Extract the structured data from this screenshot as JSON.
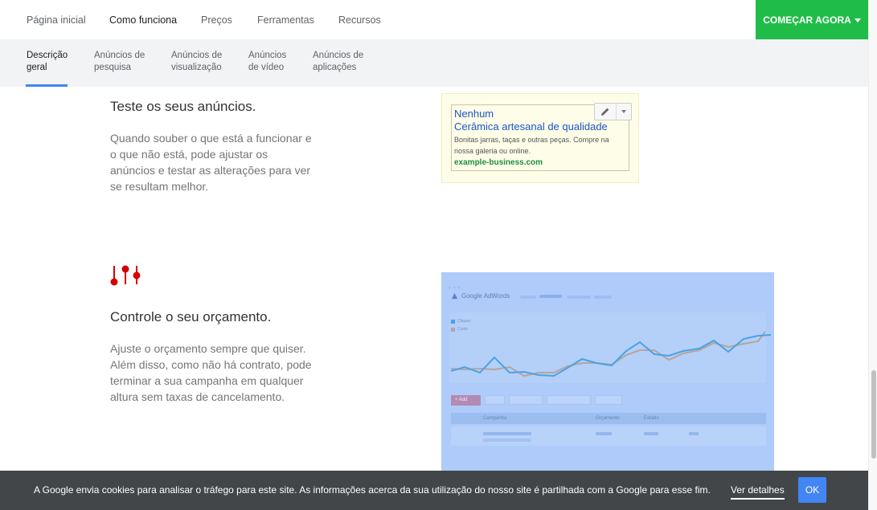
{
  "topnav": {
    "items": [
      "Página inicial",
      "Como funciona",
      "Preços",
      "Ferramentas",
      "Recursos"
    ],
    "active_index": 1,
    "cta_label": "COMEÇAR AGORA"
  },
  "subnav": {
    "items": [
      [
        "Descrição",
        "geral"
      ],
      [
        "Anúncios de",
        "pesquisa"
      ],
      [
        "Anúncios de",
        "visualização"
      ],
      [
        "Anúncios",
        "de vídeo"
      ],
      [
        "Anúncios de",
        "aplicações"
      ]
    ],
    "active_index": 0
  },
  "section_test": {
    "heading": "Teste os seus anúncios.",
    "body": "Quando souber o que está a funcionar e o que não está, pode ajustar os anúncios e testar as alterações para ver se resultam melhor."
  },
  "ad_preview": {
    "status": "Nenhum",
    "title": "Cerâmica artesanal de qualidade",
    "description": "Bonitas jarras, taças e outras peças. Compre na nossa galeria ou online.",
    "url": "example-business.com",
    "edit_icon": "pencil-icon",
    "menu_icon": "caret-down-icon"
  },
  "section_budget": {
    "icon": "sliders-icon",
    "icon_color": "#d50000",
    "heading": "Controle o seu orçamento.",
    "body": "Ajuste o orçamento sempre que quiser. Além disso, como não há contrato, pode terminar a sua campanha em qualquer altura sem taxas de cancelamento."
  },
  "dashboard_image": {
    "brand": "Google AdWords",
    "legend": [
      "Cliques",
      "Custo"
    ],
    "add_button": "+ Add",
    "columns": [
      "Campanha",
      "Orçamento",
      "Estado"
    ],
    "series_colors": [
      "#4aa3e0",
      "#b4a69c"
    ]
  },
  "cookie_bar": {
    "message": "A Google envia cookies para analisar o tráfego para este site. As informações acerca da sua utilização do nosso site é partilhada com a Google para esse fim.",
    "details_link": "Ver detalhes",
    "ok_label": "OK"
  },
  "colors": {
    "cta": "#1fbd48",
    "accent_blue": "#4285f4",
    "link_blue": "#1a56c8",
    "url_green": "#1e8e3e"
  }
}
